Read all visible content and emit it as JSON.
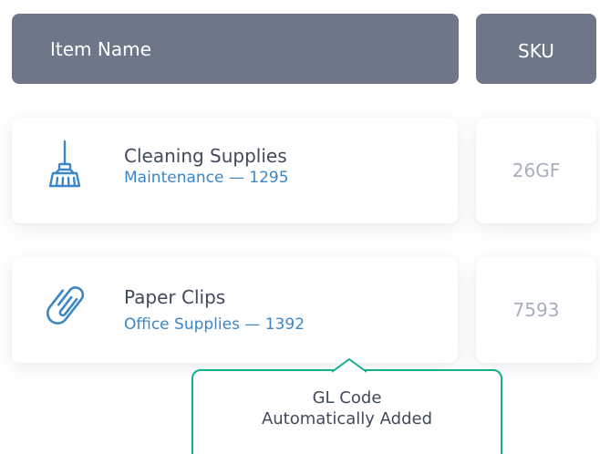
{
  "table": {
    "headers": {
      "item_name": "Item Name",
      "sku": "SKU"
    },
    "rows": [
      {
        "icon": "broom-icon",
        "title": "Cleaning Supplies",
        "subtitle": "Maintenance — 1295",
        "sku": "26GF"
      },
      {
        "icon": "paperclip-icon",
        "title": "Paper Clips",
        "subtitle": "Office Supplies — 1392",
        "sku": "7593"
      }
    ]
  },
  "tooltip": {
    "line1": "GL Code",
    "line2": "Automatically Added"
  },
  "colors": {
    "header_bg": "#6d7787",
    "accent_blue": "#3b86c6",
    "tooltip_border": "#14b08e",
    "sku_text": "#a6afbc"
  }
}
